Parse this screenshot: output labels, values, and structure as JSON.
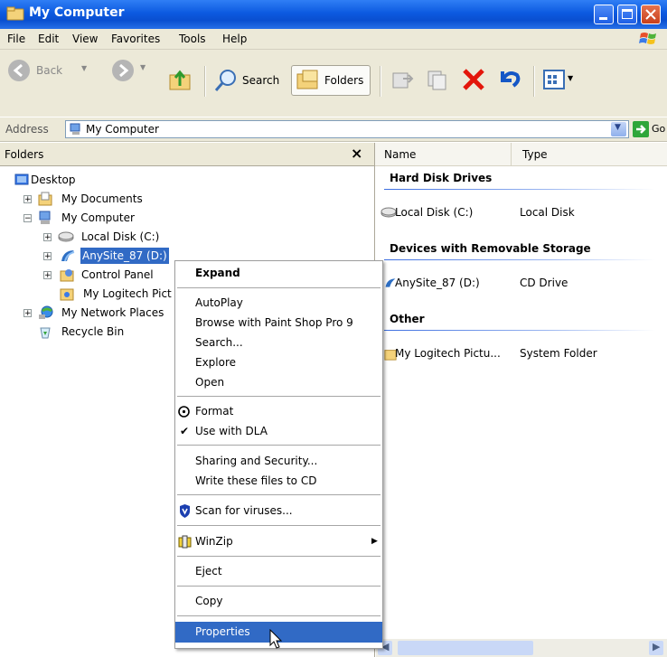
{
  "window": {
    "title": "My Computer"
  },
  "menubar": {
    "items": [
      "File",
      "Edit",
      "View",
      "Favorites",
      "Tools",
      "Help"
    ]
  },
  "toolbar": {
    "back": "Back",
    "search": "Search",
    "folders": "Folders"
  },
  "address": {
    "label": "Address",
    "value": "My Computer",
    "go": "Go"
  },
  "folders_pane": {
    "title": "Folders",
    "close": "×",
    "tree": {
      "desktop": "Desktop",
      "my_documents": "My Documents",
      "my_computer": "My Computer",
      "local_disk": "Local Disk (C:)",
      "anysite": "AnySite_87 (D:)",
      "control_panel": "Control Panel",
      "my_logitech": "My Logitech Pict",
      "network": "My Network Places",
      "recycle": "Recycle Bin"
    }
  },
  "list": {
    "columns": [
      "Name",
      "Type"
    ],
    "groups": [
      {
        "title": "Hard Disk Drives",
        "items": [
          {
            "name": "Local Disk (C:)",
            "type": "Local Disk"
          }
        ]
      },
      {
        "title": "Devices with Removable Storage",
        "items": [
          {
            "name": "AnySite_87 (D:)",
            "type": "CD Drive"
          }
        ]
      },
      {
        "title": "Other",
        "items": [
          {
            "name": "My Logitech Pictu...",
            "type": "System Folder"
          }
        ]
      }
    ]
  },
  "context_menu": {
    "expand": "Expand",
    "autoplay": "AutoPlay",
    "paintshop": "Browse with Paint Shop Pro 9",
    "search": "Search...",
    "explore": "Explore",
    "open": "Open",
    "format": "Format",
    "dla": "Use with DLA",
    "sharing": "Sharing and Security...",
    "write_cd": "Write these files to CD",
    "scan": "Scan for viruses...",
    "winzip": "WinZip",
    "eject": "Eject",
    "copy": "Copy",
    "properties": "Properties"
  },
  "colors": {
    "titlebar": "#0a4fd0",
    "selection": "#316ac5",
    "menubar": "#ece9d8"
  }
}
